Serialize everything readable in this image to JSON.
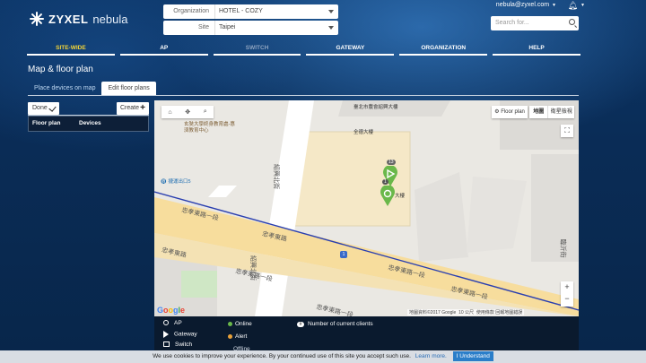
{
  "brand": {
    "name": "ZYXEL",
    "product": "nebula"
  },
  "header": {
    "organization_label": "Organization",
    "organization_value": "HOTEL - COZY",
    "site_label": "Site",
    "site_value": "Taipei",
    "user_email": "nebula@zyxel.com",
    "search_placeholder": "Search for..."
  },
  "nav": [
    {
      "label": "SITE-WIDE",
      "state": "active"
    },
    {
      "label": "AP",
      "state": "normal"
    },
    {
      "label": "SWITCH",
      "state": "disabled"
    },
    {
      "label": "GATEWAY",
      "state": "normal"
    },
    {
      "label": "ORGANIZATION",
      "state": "normal"
    },
    {
      "label": "HELP",
      "state": "normal"
    }
  ],
  "page": {
    "title": "Map & floor plan"
  },
  "tabs": [
    {
      "label": "Place devices on map",
      "active": false
    },
    {
      "label": "Edit floor plans",
      "active": true
    }
  ],
  "floor_panel": {
    "done_label": "Done",
    "create_label": "Create",
    "columns": [
      "Floor plan",
      "Devices"
    ]
  },
  "map": {
    "floor_plan_button": "Floor plan",
    "map_type_map": "地圖",
    "map_type_satellite": "衛星檢視",
    "labels": {
      "bank": "臺北市農會紹興大樓",
      "building": "全德大樓",
      "building2": "大樓",
      "school": "玄奘大學終身教育處-惠濟教育中心",
      "road_main_1": "忠孝東路一段",
      "road_main_2": "忠孝東路",
      "road_main_3": "忠孝東路",
      "road_main_4": "忠孝東路一段",
      "road_main_5": "忠孝東路一段",
      "road_main_6": "忠孝東路一段",
      "road_main_7": "忠孝東路一段",
      "road_side_1": "紹興北街",
      "road_side_2": "紹興北街",
      "road_side_3": "臨沂街",
      "station": "捷運出口5"
    },
    "marker_count": "13",
    "marker_count2": "1",
    "route_shield": "1",
    "attribution": "地圖資料©2017 Google",
    "scale": "10 公尺",
    "terms_1": "使用條款",
    "terms_2": "回報地圖錯誤",
    "zoom_in": "+",
    "zoom_out": "−",
    "google": [
      "G",
      "o",
      "o",
      "g",
      "l",
      "e"
    ]
  },
  "legend": {
    "ap": "AP",
    "gateway": "Gateway",
    "switch": "Switch",
    "online": "Online",
    "alert": "Alert",
    "offline": "Offline",
    "count_symbol": "#",
    "count_label": "Number of current clients",
    "online_color": "#6ab84a",
    "alert_color": "#e8a13a"
  },
  "cookie": {
    "message": "We use cookies to improve your experience. By your continued use of this site you accept such use.",
    "link": "Learn more.",
    "button": "I Understand"
  }
}
